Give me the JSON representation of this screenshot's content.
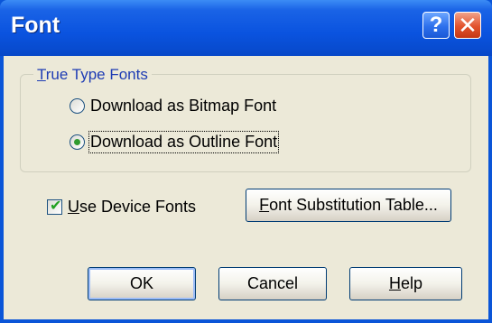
{
  "window": {
    "title": "Font",
    "help_glyph": "?",
    "close_glyph": "✕"
  },
  "truetype_group": {
    "legend_first": "T",
    "legend_rest": "rue Type Fonts",
    "options": [
      {
        "label": "Download as Bitmap Font",
        "checked": false
      },
      {
        "label": "Download as Outline Font",
        "checked": true
      }
    ]
  },
  "device_fonts": {
    "checked": true,
    "check_glyph": "✔",
    "label_first": "U",
    "label_rest": "se Device Fonts"
  },
  "substitution_button": {
    "label_first": "F",
    "label_rest": "ont Substitution Table..."
  },
  "buttons": {
    "ok": "OK",
    "cancel": "Cancel",
    "help_first": "H",
    "help_rest": "elp"
  },
  "colors": {
    "titlebar": "#0a53df",
    "client_bg": "#ece9d8",
    "legend_text": "#1e3cb4",
    "close_red": "#e2522c",
    "check_green": "#21a121"
  }
}
